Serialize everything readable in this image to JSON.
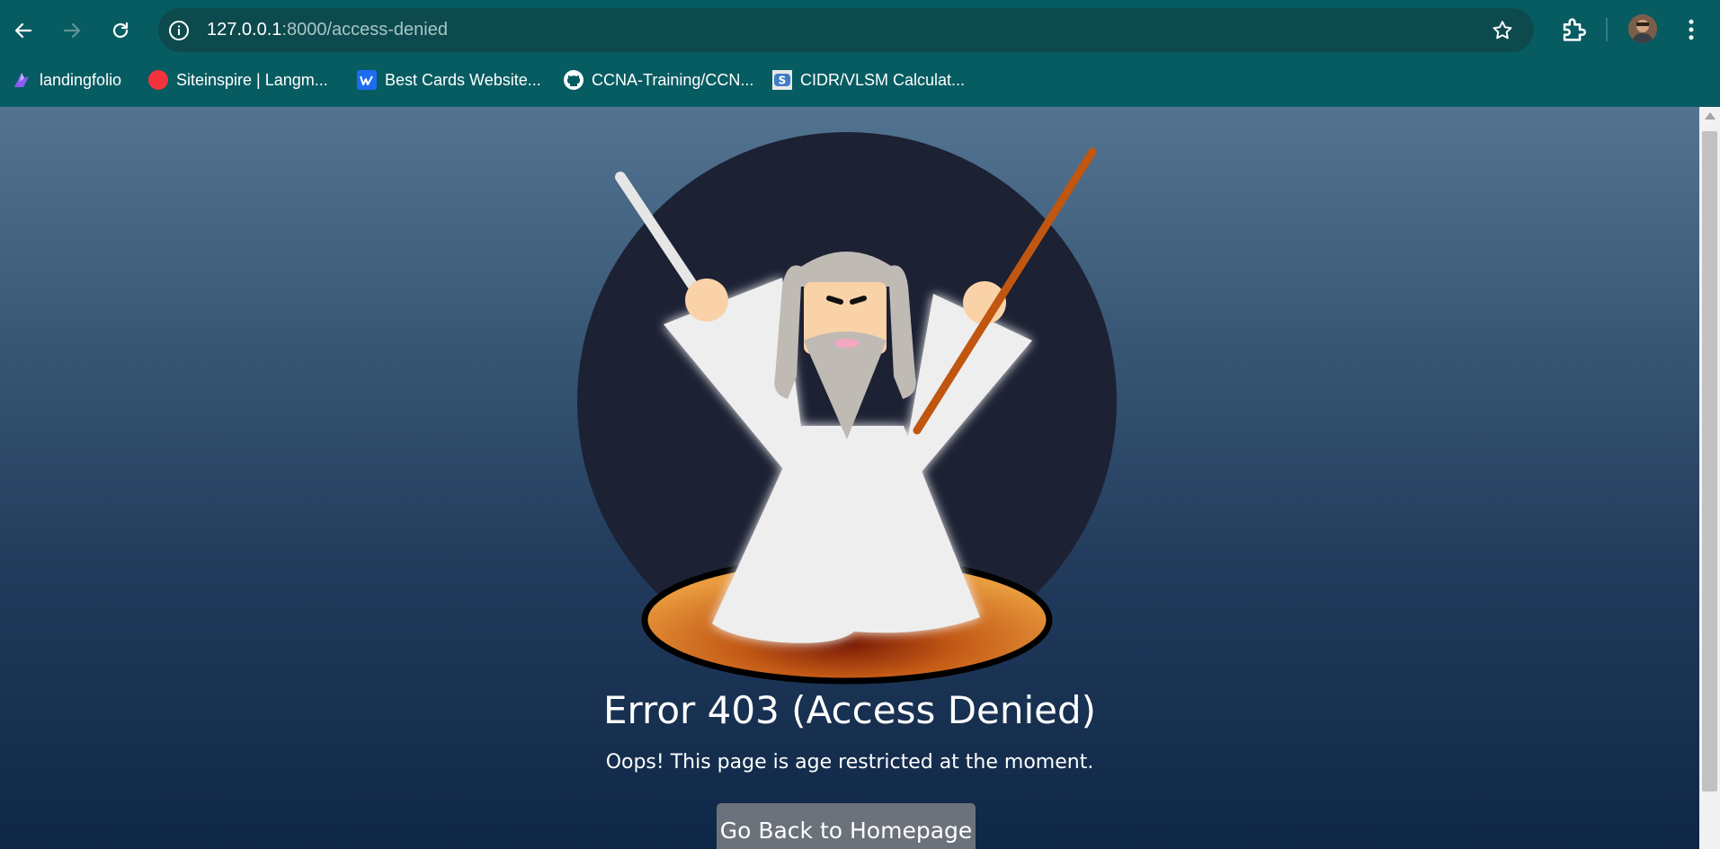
{
  "browser": {
    "url_host": "127.0.0.1",
    "url_path": ":8000/access-denied",
    "bookmarks": [
      {
        "label": "landingfolio",
        "icon": "landingfolio-icon"
      },
      {
        "label": "Siteinspire | Langm...",
        "icon": "siteinspire-icon"
      },
      {
        "label": "Best Cards Website...",
        "icon": "webflow-icon"
      },
      {
        "label": "CCNA-Training/CCN...",
        "icon": "github-icon"
      },
      {
        "label": "CIDR/VLSM Calculat...",
        "icon": "cidr-calculator-icon"
      }
    ]
  },
  "page": {
    "title": "Error 403 (Access Denied)",
    "message": "Oops! This page is age restricted at the moment.",
    "button_label": "Go Back to Homepage"
  },
  "colors": {
    "chrome": "#075c62",
    "omnibox": "#0d4a4d",
    "bg_top": "#537491",
    "bg_bottom": "#0f2747",
    "circle": "#1c2133",
    "staff": "#c0560f",
    "sword": "#e6e6e6",
    "robe": "#eeeeee",
    "hair": "#bfbab3",
    "button": "#6b727b"
  }
}
